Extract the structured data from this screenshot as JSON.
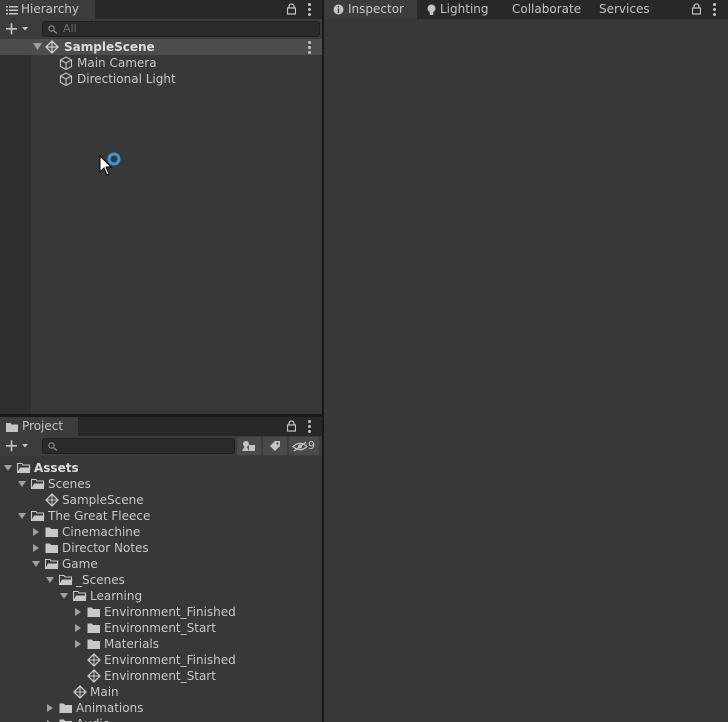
{
  "hierarchy": {
    "tab_label": "Hierarchy",
    "search_placeholder": "All",
    "scene_name": "SampleScene",
    "objects": [
      {
        "label": "Main Camera"
      },
      {
        "label": "Directional Light"
      }
    ]
  },
  "inspector_tabs": [
    {
      "label": "Inspector",
      "icon": "info-icon"
    },
    {
      "label": "Lighting",
      "icon": "lightbulb-icon"
    },
    {
      "label": "Collaborate"
    },
    {
      "label": "Services"
    }
  ],
  "project": {
    "tab_label": "Project",
    "search_placeholder": "",
    "hidden_count": "9",
    "tree": [
      {
        "label": "Assets",
        "type": "folder-open",
        "expand": "open",
        "indent": 0,
        "bold": true
      },
      {
        "label": "Scenes",
        "type": "folder-open",
        "expand": "open",
        "indent": 1
      },
      {
        "label": "SampleScene",
        "type": "scene",
        "expand": "none",
        "indent": 2
      },
      {
        "label": "The Great Fleece",
        "type": "folder-open",
        "expand": "open",
        "indent": 1
      },
      {
        "label": "Cinemachine",
        "type": "folder",
        "expand": "closed",
        "indent": 2
      },
      {
        "label": "Director Notes",
        "type": "folder",
        "expand": "closed",
        "indent": 2
      },
      {
        "label": "Game",
        "type": "folder-open",
        "expand": "open",
        "indent": 2
      },
      {
        "label": "_Scenes",
        "type": "folder-open",
        "expand": "open",
        "indent": 3
      },
      {
        "label": "Learning",
        "type": "folder-open",
        "expand": "open",
        "indent": 4
      },
      {
        "label": "Environment_Finished",
        "type": "folder",
        "expand": "closed",
        "indent": 5
      },
      {
        "label": "Environment_Start",
        "type": "folder",
        "expand": "closed",
        "indent": 5
      },
      {
        "label": "Materials",
        "type": "folder",
        "expand": "closed",
        "indent": 5
      },
      {
        "label": "Environment_Finished",
        "type": "scene",
        "expand": "none",
        "indent": 5
      },
      {
        "label": "Environment_Start",
        "type": "scene",
        "expand": "none",
        "indent": 5
      },
      {
        "label": "Main",
        "type": "scene",
        "expand": "none",
        "indent": 4
      },
      {
        "label": "Animations",
        "type": "folder",
        "expand": "closed",
        "indent": 3
      },
      {
        "label": "Audio",
        "type": "folder",
        "expand": "closed",
        "indent": 3
      }
    ]
  },
  "colors": {
    "panel_bg": "#383838",
    "tab_bar": "#282828",
    "selected_row": "#4d4d4d",
    "loading_spinner": "#3a96dd"
  }
}
